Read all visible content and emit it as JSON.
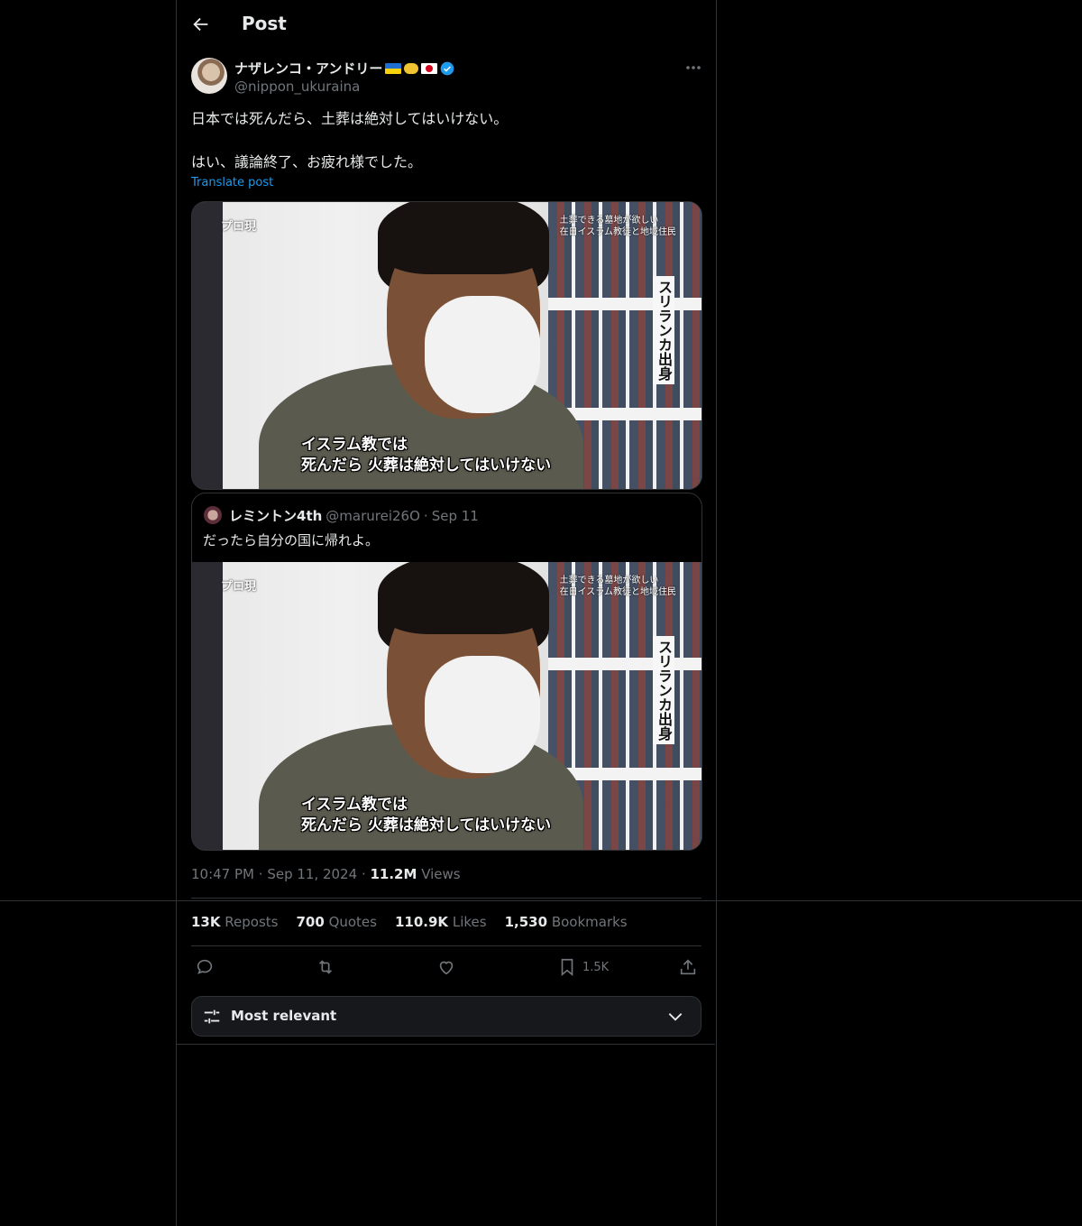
{
  "header": {
    "title": "Post"
  },
  "post": {
    "author_name": "ナザレンコ・アンドリー",
    "author_handle": "@nippon_ukuraina",
    "text": "日本では死んだら、土葬は絶対してはいけない。\n\nはい、議論終了、お疲れ様でした。",
    "translate_label": "Translate post",
    "time": "10:47 PM",
    "date": "Sep 11, 2024",
    "views_count": "11.2M",
    "views_label": "Views",
    "media": {
      "corner_text": "プロ現",
      "top_caption": "土葬できる墓地が欲しい\n在日イスラム教徒と地域住民",
      "vertical_caption": "スリランカ出身",
      "main_caption": "イスラム教では\n死んだら 火葬は絶対してはいけない"
    }
  },
  "quote": {
    "author_name": "レミントン4th",
    "author_handle": "@marurei26O",
    "date": "Sep 11",
    "text": "だったら自分の国に帰れよ。"
  },
  "stats": {
    "reposts_count": "13K",
    "reposts_label": "Reposts",
    "quotes_count": "700",
    "quotes_label": "Quotes",
    "likes_count": "110.9K",
    "likes_label": "Likes",
    "bookmarks_count": "1,530",
    "bookmarks_label": "Bookmarks"
  },
  "actions": {
    "bookmark_count": "1.5K"
  },
  "sort": {
    "label": "Most relevant"
  },
  "icons": {
    "back": "arrow-left-icon",
    "more": "ellipsis-icon",
    "verified": "verified-badge-icon",
    "reply": "reply-icon",
    "repost": "repost-icon",
    "like": "heart-icon",
    "bookmark": "bookmark-icon",
    "share": "share-icon",
    "sort": "sliders-icon",
    "chevron": "chevron-down-icon"
  },
  "colors": {
    "background": "#000000",
    "text": "#e7e9ea",
    "muted": "#71767b",
    "accent": "#1d9bf0",
    "border": "#2f3336"
  }
}
